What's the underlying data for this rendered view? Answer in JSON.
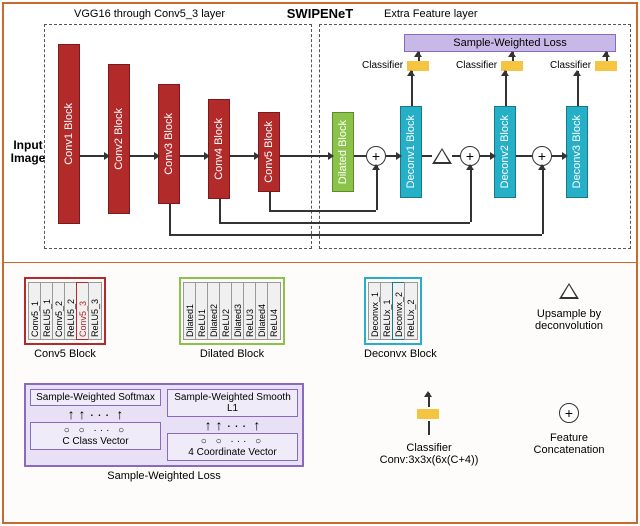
{
  "title": "SWIPENeT",
  "sections": {
    "left": "VGG16 through Conv5_3 layer",
    "right": "Extra Feature layer"
  },
  "input_label": "Input Image",
  "blocks": {
    "conv": [
      "Conv1 Block",
      "Conv2 Block",
      "Conv3 Block",
      "Conv4 Block",
      "Conv5 Block"
    ],
    "dilated": "Dilated Block",
    "deconv": [
      "Deconv1 Block",
      "Deconv2 Block",
      "Deconv3 Block"
    ]
  },
  "loss_label": "Sample-Weighted Loss",
  "classifier_label": "Classifier",
  "legend": {
    "conv5": {
      "title": "Conv5 Block",
      "items": [
        "Conv5_1",
        "ReLU5_1",
        "Conv5_2",
        "ReLU5_2",
        "Conv5_3",
        "ReLU5_3"
      ]
    },
    "dilated": {
      "title": "Dilated Block",
      "items": [
        "Dilated1",
        "ReLU1",
        "Dilated2",
        "ReLU2",
        "Dilated3",
        "ReLU3",
        "Dilated4",
        "ReLU4"
      ]
    },
    "deconv": {
      "title": "Deconvx Block",
      "items": [
        "Deconvx_1",
        "ReLUx_1",
        "Deconvx_2",
        "ReLUx_2"
      ]
    },
    "upsample": "Upsample by deconvolution",
    "concat": "Feature Concatenation",
    "classifier_desc": "Classifier Conv:3x3x(6x(C+4))",
    "swl": {
      "title": "Sample-Weighted Loss",
      "softmax": "Sample-Weighted Softmax",
      "smooth": "Sample-Weighted Smooth L1",
      "cvec": "C Class Vector",
      "coord": "4 Coordinate Vector"
    }
  }
}
